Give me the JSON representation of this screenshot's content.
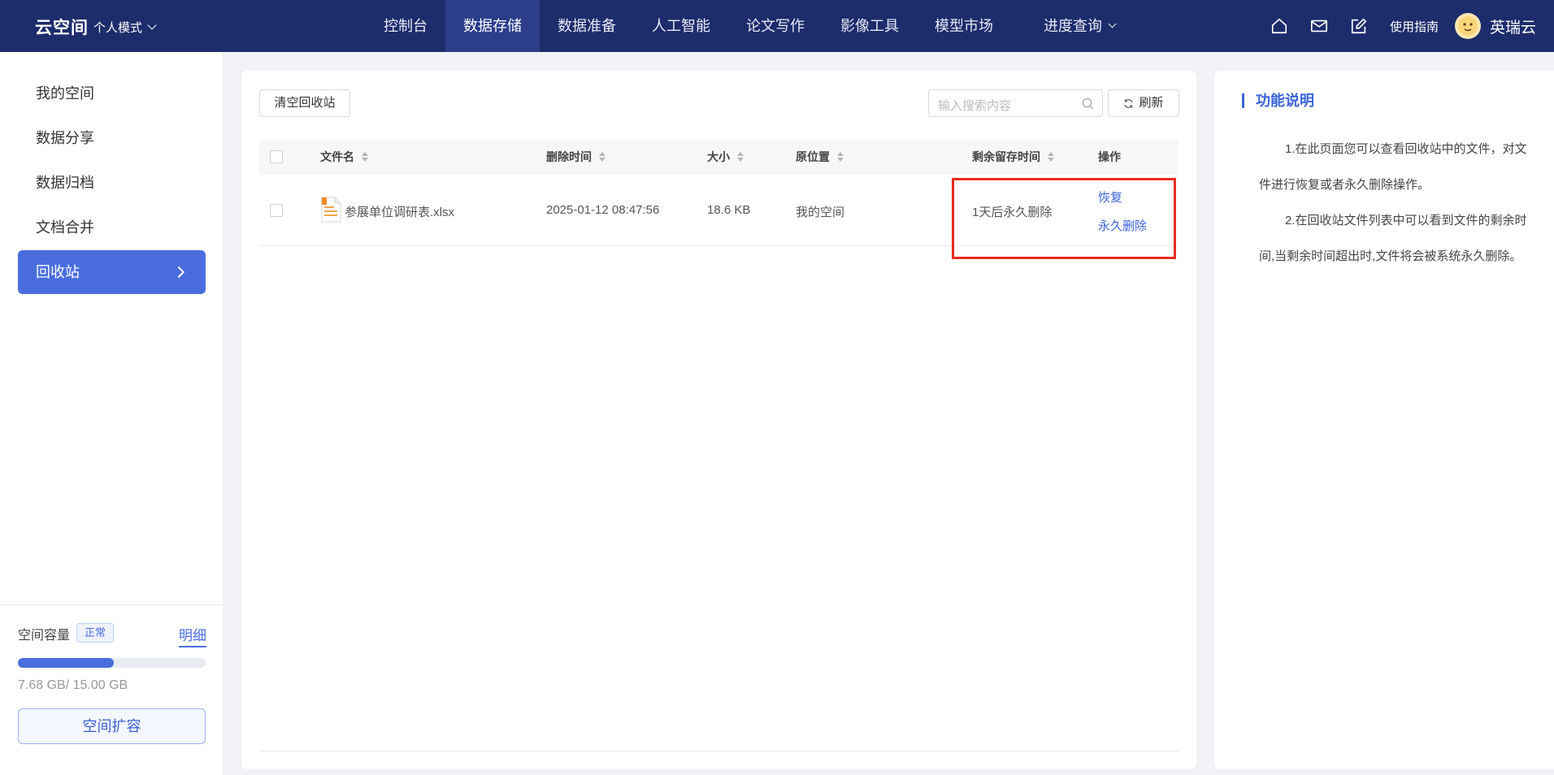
{
  "header": {
    "brand": "云空间",
    "mode": "个人模式",
    "nav": [
      {
        "label": "控制台"
      },
      {
        "label": "数据存储"
      },
      {
        "label": "数据准备"
      },
      {
        "label": "人工智能"
      },
      {
        "label": "论文写作"
      },
      {
        "label": "影像工具"
      },
      {
        "label": "模型市场"
      },
      {
        "label": "进度查询"
      }
    ],
    "active_nav": "数据存储",
    "guide": "使用指南",
    "username": "英瑞云",
    "icons": [
      "home-icon",
      "mail-icon",
      "edit-icon",
      "avatar"
    ]
  },
  "sidebar": {
    "items": [
      {
        "label": "我的空间"
      },
      {
        "label": "数据分享"
      },
      {
        "label": "数据归档"
      },
      {
        "label": "文档合并"
      },
      {
        "label": "回收站"
      }
    ],
    "active_item": "回收站",
    "storage": {
      "label": "空间容量",
      "badge": "正常",
      "detail": "明细",
      "usage_text": "7.68 GB/ 15.00 GB",
      "used_fraction": 0.512,
      "expand_label": "空间扩容"
    }
  },
  "main": {
    "clear_button": "清空回收站",
    "search_placeholder": "输入搜索内容",
    "refresh_button": "刷新",
    "columns": [
      "文件名",
      "删除时间",
      "大小",
      "原位置",
      "剩余留存时间",
      "操作"
    ],
    "rows": [
      {
        "name": "参展单位调研表.xlsx",
        "deleted_at": "2025-01-12 08:47:56",
        "size": "18.6 KB",
        "location": "我的空间",
        "remaining": "1天后永久删除",
        "actions": [
          "恢复",
          "永久删除"
        ]
      }
    ]
  },
  "help": {
    "title": "功能说明",
    "paragraphs": [
      "1.在此页面您可以查看回收站中的文件，对文件进行恢复或者永久删除操作。",
      "2.在回收站文件列表中可以看到文件的剩余时间,当剩余时间超出时,文件将会被系统永久删除。"
    ]
  },
  "colors": {
    "nav_bg": "#1d2c6b",
    "accent": "#4a6ddd",
    "link": "#3c64d8",
    "highlight": "#ea2b1e"
  }
}
